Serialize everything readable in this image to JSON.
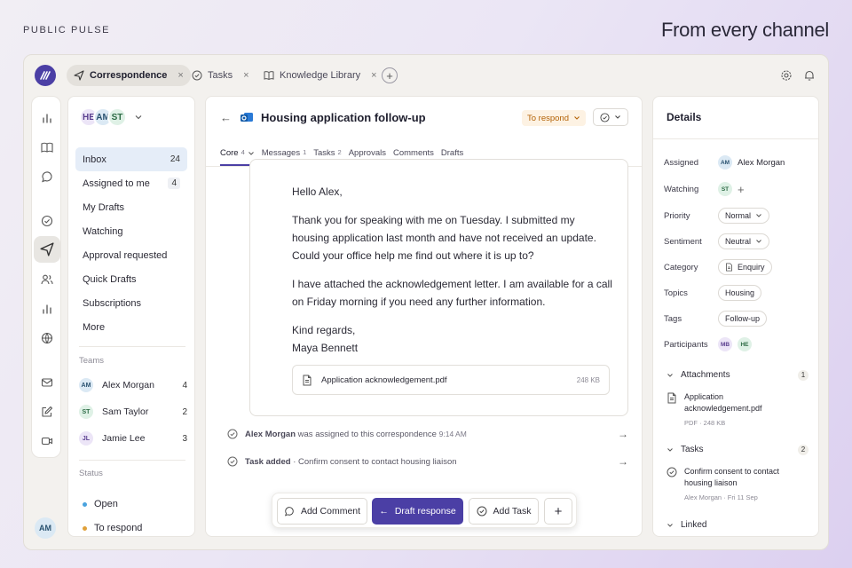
{
  "brand": "PUBLIC PULSE",
  "tagline": "From every channel",
  "tabs": [
    {
      "label": "Correspondence",
      "icon": "send-icon",
      "active": true
    },
    {
      "label": "Tasks",
      "icon": "check-circle-icon",
      "active": false
    },
    {
      "label": "Knowledge Library",
      "icon": "book-icon",
      "active": false
    }
  ],
  "user_initials": "AM",
  "left": {
    "avatars": [
      "HE",
      "AM",
      "ST"
    ],
    "nav": [
      {
        "label": "Inbox",
        "count": "24"
      },
      {
        "label": "Assigned to me",
        "count": "4"
      },
      {
        "label": "My Drafts",
        "count": ""
      },
      {
        "label": "Watching",
        "count": ""
      },
      {
        "label": "Approval requested",
        "count": ""
      },
      {
        "label": "Quick Drafts",
        "count": ""
      },
      {
        "label": "Subscriptions",
        "count": ""
      },
      {
        "label": "More",
        "count": ""
      }
    ],
    "teams_label": "Teams",
    "teams": [
      {
        "initials": "AM",
        "name": "Alex Morgan",
        "count": "4"
      },
      {
        "initials": "ST",
        "name": "Sam Taylor",
        "count": "2"
      },
      {
        "initials": "JL",
        "name": "Jamie Lee",
        "count": "3"
      }
    ],
    "status_label": "Status",
    "statuses": [
      {
        "label": "Open",
        "color": "#4aa3df"
      },
      {
        "label": "To respond",
        "color": "#e0a13a"
      }
    ]
  },
  "main": {
    "title": "Housing application follow-up",
    "status": "To respond",
    "subtabs": [
      {
        "label": "Core",
        "count": "4"
      },
      {
        "label": "Messages",
        "count": "1"
      },
      {
        "label": "Tasks",
        "count": "2"
      },
      {
        "label": "Approvals",
        "count": ""
      },
      {
        "label": "Comments",
        "count": ""
      },
      {
        "label": "Drafts",
        "count": ""
      }
    ],
    "email": {
      "greeting": "Hello Alex,",
      "para1": "Thank you for speaking with me on Tuesday. I submitted my housing application last month and have not received an update. Could your office help me find out where it is up to?",
      "para2": "I have attached the acknowledgement letter. I am available for a call on Friday morning if you need any further information.",
      "signoff": "Kind regards,",
      "signature": "Maya Bennett",
      "attachment_name": "Application acknowledgement.pdf",
      "attachment_size": "248 KB"
    },
    "activity": [
      {
        "actor": "Alex Morgan",
        "text": "was assigned to this correspondence",
        "time": "9:14 AM"
      },
      {
        "actor": "Task added",
        "text": "· Confirm consent to contact housing liaison",
        "time": ""
      }
    ],
    "toolbar": {
      "comment": "Add Comment",
      "draft": "Draft response",
      "task": "Add Task"
    }
  },
  "details": {
    "title": "Details",
    "assigned_label": "Assigned",
    "assigned_initials": "AM",
    "assigned_name": "Alex Morgan",
    "watching_label": "Watching",
    "watching_initials": "ST",
    "priority_label": "Priority",
    "priority": "Normal",
    "sentiment_label": "Sentiment",
    "sentiment": "Neutral",
    "category_label": "Category",
    "category": "Enquiry",
    "topics_label": "Topics",
    "topic": "Housing",
    "tags_label": "Tags",
    "tag": "Follow-up",
    "participants_label": "Participants",
    "participants": [
      "MB",
      "HE"
    ],
    "attachments_label": "Attachments",
    "attachments_count": "1",
    "attachment_name": "Application acknowledgement.pdf",
    "attachment_meta": "PDF · 248 KB",
    "tasks_label": "Tasks",
    "tasks_count": "2",
    "task_name": "Confirm consent to contact housing liaison",
    "task_meta": "Alex Morgan · Fri 11 Sep",
    "linked_label": "Linked"
  }
}
